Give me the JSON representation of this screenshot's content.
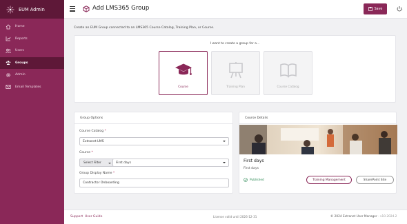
{
  "sidebar": {
    "brand": "EUM Admin",
    "items": [
      {
        "label": "Home",
        "icon": "home-icon",
        "active": false
      },
      {
        "label": "Reports",
        "icon": "chart-icon",
        "active": false
      },
      {
        "label": "Users",
        "icon": "users-icon",
        "active": false
      },
      {
        "label": "Groups",
        "icon": "groups-icon",
        "active": true
      },
      {
        "label": "Admin",
        "icon": "gear-icon",
        "active": false
      },
      {
        "label": "Email Templates",
        "icon": "email-icon",
        "active": false
      }
    ]
  },
  "header": {
    "title": "Add LMS365 Group",
    "save_label": "Save"
  },
  "main": {
    "intro": "Create an EUM Group connected to an LMS365 Course Catalog, Training Plan, or Course.",
    "type_prompt": "I want to create a group for a...",
    "types": [
      {
        "label": "Course",
        "selected": true
      },
      {
        "label": "Training Plan",
        "selected": false
      },
      {
        "label": "Course Catalog",
        "selected": false
      }
    ]
  },
  "group_options": {
    "title": "Group Options",
    "catalog_label": "Course Catalog",
    "catalog_value": "Extranet LMS",
    "course_label": "Course",
    "filter_label": "Select Filter",
    "course_value": "First days",
    "display_name_label": "Group Display Name",
    "display_name_value": "Contractor Onboarding",
    "required_mark": "*"
  },
  "course_details": {
    "title": "Course Details",
    "course_title": "First days",
    "course_subtitle": "First days",
    "status": "Published",
    "training_btn": "Training Management",
    "sharepoint_btn": "SharePoint Site"
  },
  "footer": {
    "support": "Support",
    "user_guide": "User Guide",
    "license": "License valid until 2026-12-31",
    "copyright": "© 2024 Extranet User Manager",
    "version": " - v10.2024.2"
  },
  "colors": {
    "brand": "#8a2858",
    "brand_dark": "#5e1838",
    "success": "#2e8b57"
  }
}
